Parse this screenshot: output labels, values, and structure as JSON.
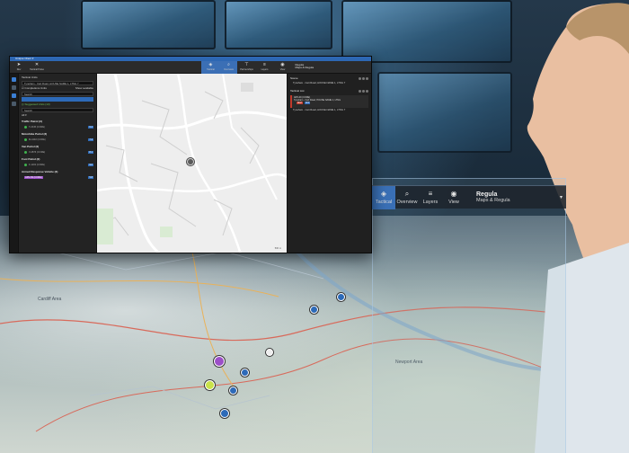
{
  "small_window": {
    "title": "Unique Client ▾",
    "toolbar": {
      "buttons": [
        {
          "label": "Rev",
          "icon": "cursor-icon"
        },
        {
          "label": "Tactical Pulse",
          "icon": "crosshair-icon"
        }
      ],
      "active_buttons": [
        {
          "label": "Tactical",
          "icon": "map-icon"
        },
        {
          "label": "Overview",
          "icon": "search-icon"
        },
        {
          "label": "Partnerships",
          "icon": "layers-icon"
        },
        {
          "label": "Layers",
          "icon": "stack-icon"
        },
        {
          "label": "View",
          "icon": "eye-icon"
        }
      ],
      "region_title": "Regula",
      "region_subtitle": "Maps & Regula"
    },
    "left_panel": {
      "section_title": "Tactical Units",
      "search_value": "Tyneham - Cart Road, HOUSE NAME 1, LTNG 7",
      "checkbox_label": "Completions Units",
      "filter_label": "Show available",
      "search2_placeholder": "Search",
      "suggested_label": "Suggested Units (13)",
      "filter2": "Search",
      "sort_label": "All ▾",
      "groups": [
        {
          "name": "Traffic Patrol (3)",
          "units": [
            "T-2345 (CORE)",
            "22:12 - 07:25 ETA"
          ]
        },
        {
          "name": "Motorbike Patrol (3)",
          "units": [
            "M-4432 (CORE)",
            "22:14 - 07:30 ETA"
          ]
        },
        {
          "name": "Van Patrol (2)",
          "units": [
            "V-2876 (CORE)",
            "22:11 - 07:28 ETA"
          ]
        },
        {
          "name": "Foot Patrol (2)",
          "units": [
            "F-1193 (CORE)",
            "22:09 - 07:32 ETA"
          ]
        },
        {
          "name": "Armed Response Vehicle (3)",
          "units": [
            "ARV-09 (CORE)",
            "22:15 - 07:35 ETA"
          ]
        }
      ],
      "badges": [
        "6.2",
        "7.4",
        "8.1",
        "9.0",
        "5.8"
      ]
    },
    "right_panel": {
      "header1": "Scene",
      "item1": "Tyneham - Cart Road, HOUSE NAME 1, LTNG 7",
      "header2": "Tactical List",
      "card_title": "ARV-09 (CORE)",
      "card_sub": "Tyneham - Cart Road, HOUSE NAME 1, LTNG",
      "card_tag1": "Alert",
      "card_tag2": "Unit",
      "item2": "Tyneham - Cart Road, HOUSE NAME 1, LTNG 7"
    },
    "map": {
      "scale_text": "500 m"
    }
  },
  "big_window": {
    "toolbar": [
      {
        "label": "Tactical",
        "icon": "map-icon"
      },
      {
        "label": "Overview",
        "icon": "search-icon"
      },
      {
        "label": "Layers",
        "icon": "stack-icon"
      },
      {
        "label": "View",
        "icon": "eye-icon"
      }
    ],
    "region_title": "Regula",
    "region_subtitle": "Maps & Regula"
  },
  "big_map_labels": [
    "Cardiff Area",
    "Newport Area"
  ],
  "colors": {
    "accent": "#3b6fb5",
    "alert": "#c0392b",
    "unit_green": "#3fb34f",
    "unit_purple": "#9c4fc8"
  }
}
